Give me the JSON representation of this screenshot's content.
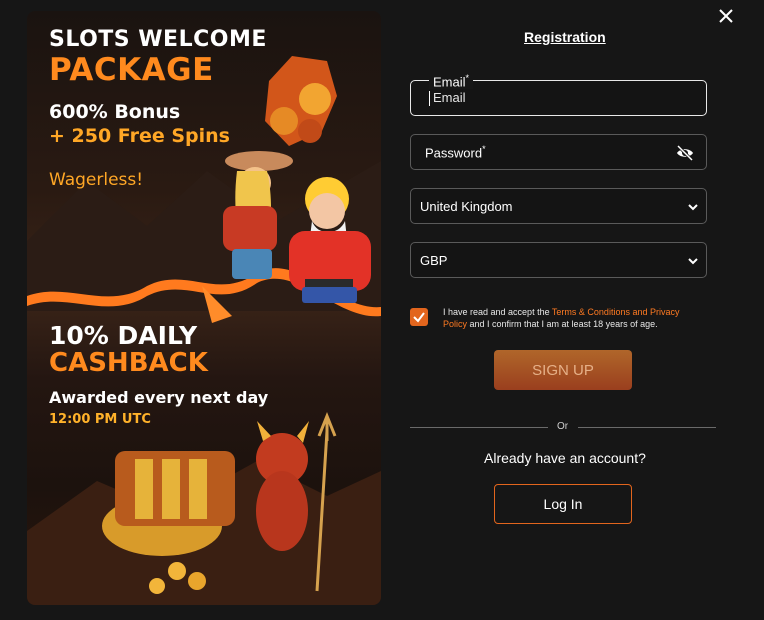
{
  "promo": {
    "welcome": "SLOTS WELCOME",
    "package": "PACKAGE",
    "bonus": "600% Bonus",
    "spins": "+ 250 Free Spins",
    "wagerless": "Wagerless!",
    "daily": "10% DAILY",
    "cashback": "CASHBACK",
    "awarded": "Awarded every next day",
    "time": "12:00 PM UTC"
  },
  "form": {
    "title": "Registration",
    "email": {
      "label": "Email",
      "required_mark": "*",
      "placeholder": "Email"
    },
    "password": {
      "label": "Password",
      "required_mark": "*"
    },
    "country": {
      "selected": "United Kingdom"
    },
    "currency": {
      "selected": "GBP"
    },
    "terms": {
      "prefix": "I have read and accept the ",
      "link": "Terms & Conditions and Privacy Policy",
      "suffix": " and I confirm that I am at least 18 years of age.",
      "checked": true
    },
    "signup_label": "SIGN UP",
    "or_label": "Or",
    "have_account": "Already have an account?",
    "login_label": "Log In"
  },
  "colors": {
    "accent": "#e2651d",
    "orange_text": "#ff8a1e",
    "background": "#161616"
  },
  "icons": {
    "close": "close-icon",
    "eye": "eye-off-icon",
    "chevron": "chevron-down-icon",
    "check": "checkmark-icon"
  }
}
